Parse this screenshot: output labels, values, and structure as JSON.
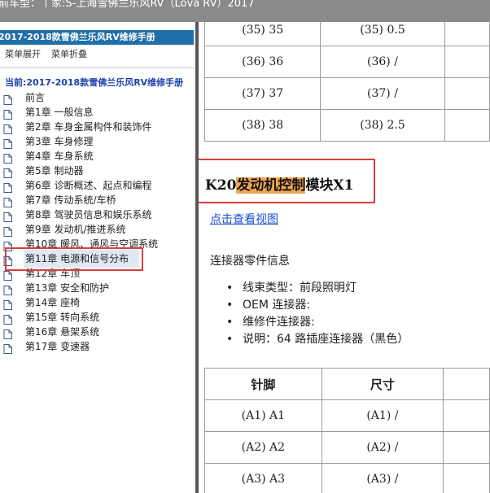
{
  "window": {
    "title": "前车型：丨家:S-上海雪佛兰乐风RV（Lova RV）2017"
  },
  "sidebar": {
    "header": "2017-2018款雪佛兰乐风RV维修手册",
    "toolbar": {
      "expand_label": "菜单展开",
      "collapse_label": "菜单折叠"
    },
    "current_label": "当前:2017-2018款雪佛兰乐风RV维修手册",
    "items": [
      {
        "label": "前言"
      },
      {
        "label": "第1章 一般信息"
      },
      {
        "label": "第2章 车身金属构件和装饰件"
      },
      {
        "label": "第3章 车身修理"
      },
      {
        "label": "第4章 车身系统"
      },
      {
        "label": "第5章 制动器"
      },
      {
        "label": "第6章 诊断概述、起点和编程"
      },
      {
        "label": "第7章 传动系统/车桥"
      },
      {
        "label": "第8章 驾驶员信息和娱乐系统"
      },
      {
        "label": "第9章 发动机/推进系统"
      },
      {
        "label": "第10章 暖风、通风与空调系统"
      },
      {
        "label": "第11章 电源和信号分布"
      },
      {
        "label": "第12章 车顶"
      },
      {
        "label": "第13章 安全和防护"
      },
      {
        "label": "第14章 座椅"
      },
      {
        "label": "第15章 转向系统"
      },
      {
        "label": "第16章 悬架系统"
      },
      {
        "label": "第17章 变速器"
      }
    ],
    "selected_index": 11
  },
  "content": {
    "top_table": {
      "rows": [
        [
          "(35) 35",
          "(35) 0.5",
          ""
        ],
        [
          "(36) 36",
          "(36) /",
          ""
        ],
        [
          "(37) 37",
          "(37) /",
          ""
        ],
        [
          "(38) 38",
          "(38) 2.5",
          ""
        ]
      ]
    },
    "section_title_prefix": "K20",
    "section_title_highlight": "发动机控制",
    "section_title_suffix": "模块X1",
    "view_link": "点击查看视图",
    "connector_info_label": "连接器零件信息",
    "bullets": [
      "线束类型：前段照明灯",
      "OEM 连接器:",
      "维修件连接器:",
      "说明：64 路插座连接器（黑色）"
    ],
    "pin_table": {
      "headers": [
        "针脚",
        "尺寸",
        ""
      ],
      "rows": [
        [
          "(A1) A1",
          "(A1) /",
          ""
        ],
        [
          "(A2) A2",
          "(A2) /",
          ""
        ],
        [
          "(A3) A3",
          "(A3) /",
          ""
        ]
      ]
    }
  },
  "colors": {
    "sidebar_header_bg": "#1f6fa8",
    "annotation_box": "#d9403a",
    "title_highlight": "#f0a650",
    "link": "#1a4fcf"
  }
}
